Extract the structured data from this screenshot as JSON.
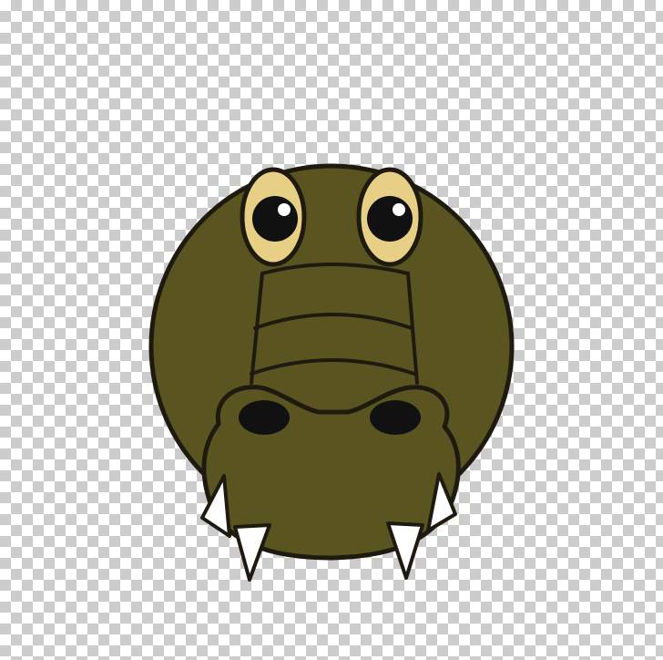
{
  "illustration": {
    "subject": "crocodile-head-cartoon",
    "background": "transparency-checkerboard",
    "colors": {
      "checker_light": "#ffffff",
      "checker_dark": "#cccccc",
      "skin": "#5a5520",
      "outline": "#1e1a10",
      "eye_white": "#e8cf86",
      "pupil": "#111111",
      "highlight": "#ffffff",
      "nostril": "#111111",
      "teeth": "#ffffff"
    }
  }
}
